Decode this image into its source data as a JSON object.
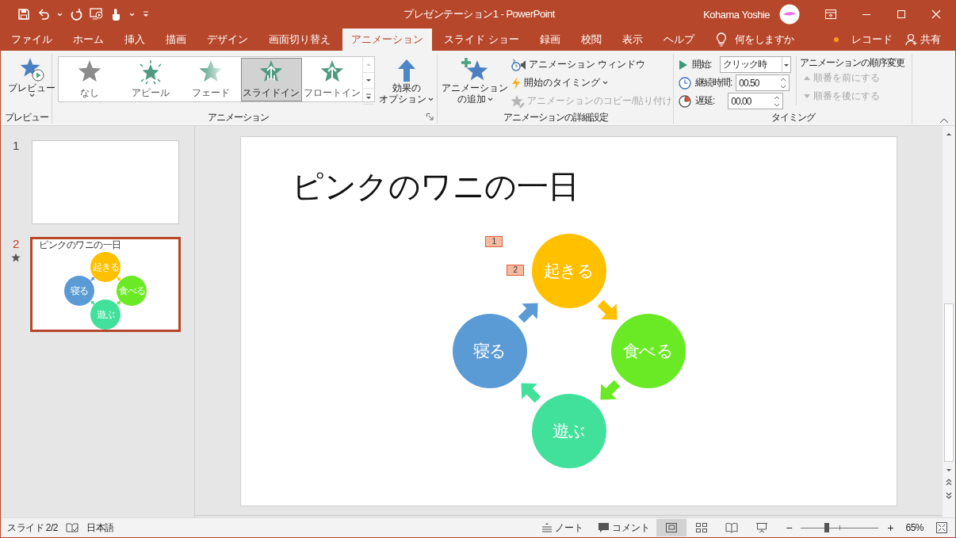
{
  "window": {
    "title": "プレゼンテーション1  -  PowerPoint",
    "user": "Kohama Yoshie"
  },
  "ribbon_tabs": [
    {
      "label": "ファイル",
      "selected": false
    },
    {
      "label": "ホーム",
      "selected": false
    },
    {
      "label": "挿入",
      "selected": false
    },
    {
      "label": "描画",
      "selected": false
    },
    {
      "label": "デザイン",
      "selected": false
    },
    {
      "label": "画面切り替え",
      "selected": false
    },
    {
      "label": "アニメーション",
      "selected": true
    },
    {
      "label": "スライド ショー",
      "selected": false
    },
    {
      "label": "録画",
      "selected": false
    },
    {
      "label": "校閲",
      "selected": false
    },
    {
      "label": "表示",
      "selected": false
    },
    {
      "label": "ヘルプ",
      "selected": false
    }
  ],
  "tell_me": "何をしますか",
  "record": "レコード",
  "share": "共有",
  "ribbon": {
    "preview_group": {
      "button": "プレビュー",
      "label": "プレビュー"
    },
    "animation_group": {
      "label": "アニメーション",
      "gallery": [
        {
          "label": "なし",
          "kind": "none",
          "selected": false
        },
        {
          "label": "アピール",
          "kind": "appear",
          "selected": false
        },
        {
          "label": "フェード",
          "kind": "fade",
          "selected": false
        },
        {
          "label": "スライドイン",
          "kind": "flyin",
          "selected": true
        },
        {
          "label": "フロートイン",
          "kind": "floatin",
          "selected": false
        }
      ],
      "effect_options": [
        "効果の",
        "オプション"
      ]
    },
    "advanced_group": {
      "label": "アニメーションの詳細設定",
      "add_animation": [
        "アニメーション",
        "の追加"
      ],
      "items": [
        {
          "label": "アニメーション ウィンドウ",
          "kind": "pane",
          "disabled": false
        },
        {
          "label": "開始のタイミング",
          "kind": "trigger",
          "disabled": false
        },
        {
          "label": "アニメーションのコピー/貼り付け",
          "kind": "painter",
          "disabled": true
        }
      ]
    },
    "timing_group": {
      "label": "タイミング",
      "start": {
        "label": "開始:",
        "value": "クリック時"
      },
      "duration": {
        "label": "継続時間:",
        "value": "00.50"
      },
      "delay": {
        "label": "遅延:",
        "value": "00.00"
      },
      "reorder": {
        "title": "アニメーションの順序変更",
        "items": [
          {
            "label": "順番を前にする",
            "kind": "up",
            "disabled": true
          },
          {
            "label": "順番を後にする",
            "kind": "down",
            "disabled": true
          }
        ]
      }
    }
  },
  "thumbnails": [
    {
      "number": "1",
      "selected": false,
      "animated": false
    },
    {
      "number": "2",
      "selected": true,
      "animated": true,
      "title": "ピンクのワニの一日",
      "nodes": [
        {
          "label": "起きる",
          "color": "#ffc000"
        },
        {
          "label": "食べる",
          "color": "#6aea25"
        },
        {
          "label": "遊ぶ",
          "color": "#41e09b"
        },
        {
          "label": "寝る",
          "color": "#5b9bd5"
        }
      ]
    }
  ],
  "slide": {
    "title": "ピンクのワニの一日",
    "nodes": [
      {
        "label": "起きる",
        "color": "#ffc000"
      },
      {
        "label": "食べる",
        "color": "#6aea25"
      },
      {
        "label": "遊ぶ",
        "color": "#41e09b"
      },
      {
        "label": "寝る",
        "color": "#5b9bd5"
      }
    ],
    "badges": [
      "1",
      "2"
    ]
  },
  "status_bar": {
    "slide": "スライド 2/2",
    "language": "日本語",
    "notes": "ノート",
    "comments": "コメント",
    "views": [
      {
        "kind": "normal",
        "selected": true
      },
      {
        "kind": "sorter",
        "selected": false
      },
      {
        "kind": "reading",
        "selected": false
      },
      {
        "kind": "slideshow",
        "selected": false
      }
    ],
    "zoom": {
      "minus": "−",
      "plus": "+",
      "level": 0.33,
      "value": "65%"
    }
  }
}
